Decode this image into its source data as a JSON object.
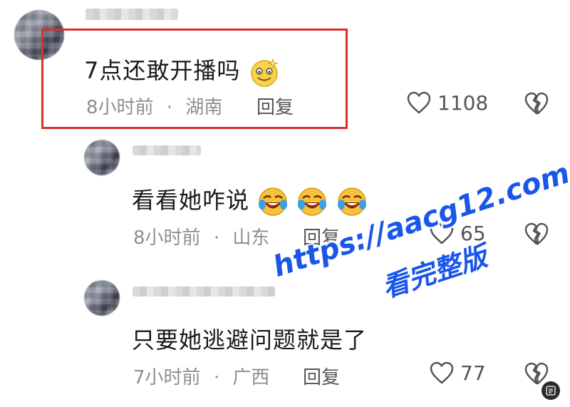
{
  "comments": [
    {
      "text": "7点还敢开播吗",
      "emoji": "smiling-face-icon",
      "time": "8小时前",
      "location": "湖南",
      "reply_label": "回复",
      "likes": "1108"
    },
    {
      "text": "看看她咋说",
      "emoji": "laughing-tears-icon",
      "time": "8小时前",
      "location": "山东",
      "reply_label": "回复",
      "likes": "65"
    },
    {
      "text": "只要她逃避问题就是了",
      "time": "7小时前",
      "location": "广西",
      "reply_label": "回复",
      "likes": "77"
    }
  ],
  "separator": "·",
  "watermark": {
    "url": "https://aacg12.com",
    "subtitle": "看完整版"
  },
  "colors": {
    "highlight_border": "#d8312e",
    "watermark": "#1a56e8",
    "meta_text": "#8e8e8e"
  }
}
